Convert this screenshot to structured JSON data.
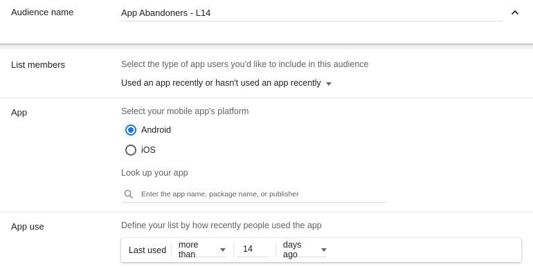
{
  "audience_name": {
    "label": "Audience name",
    "value": "App Abandoners - L14"
  },
  "list_members": {
    "label": "List members",
    "description": "Select the type of app users you'd like to include in this audience",
    "selected": "Used an app recently or hasn't used an app recently"
  },
  "app": {
    "label": "App",
    "platform_description": "Select your mobile app's platform",
    "platforms": [
      {
        "label": "Android",
        "checked": true
      },
      {
        "label": "iOS",
        "checked": false
      }
    ],
    "lookup_label": "Look up your app",
    "search_placeholder": "Enter the app name, package name, or publisher"
  },
  "app_use": {
    "label": "App use",
    "description": "Define your list by how recently people used the app",
    "rule": {
      "prefix": "Last used",
      "comparator": "more than",
      "amount": "14",
      "unit": "days ago"
    }
  },
  "icons": {
    "collapse": "chevron-up-icon",
    "search": "search-icon",
    "dropdown": "caret-down-icon"
  },
  "colors": {
    "accent": "#1a73e8",
    "text": "#202124",
    "secondary_text": "#5f6368",
    "divider": "#e0e0e0"
  }
}
